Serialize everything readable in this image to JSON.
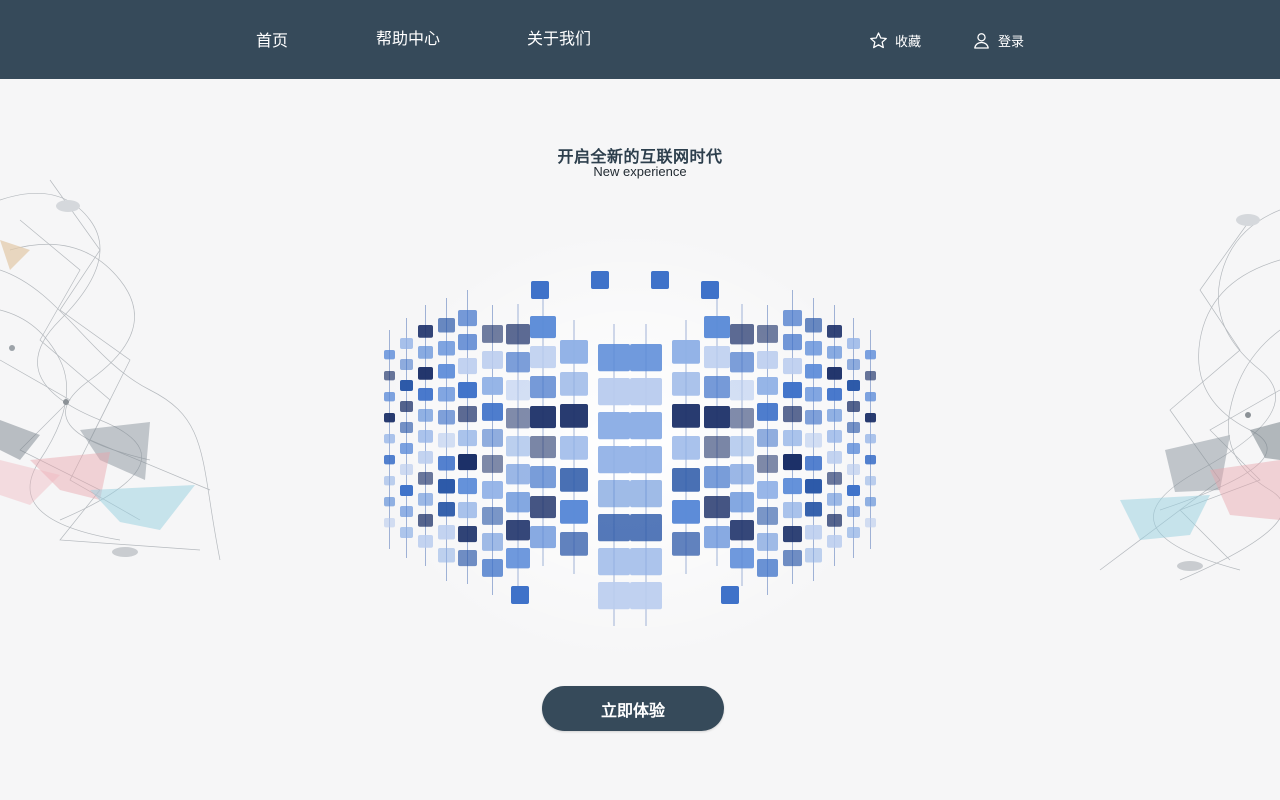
{
  "nav": {
    "items": [
      {
        "label": "首页"
      },
      {
        "label": "帮助中心"
      },
      {
        "label": "关于我们"
      }
    ],
    "favorite": {
      "label": "收藏",
      "icon": "star-icon"
    },
    "login": {
      "label": "登录",
      "icon": "user-icon"
    }
  },
  "hero": {
    "title": "开启全新的互联网时代",
    "subtitle": "New experience"
  },
  "cta": {
    "label": "立即体验"
  },
  "colors": {
    "navbar": "#364a5a",
    "background": "#f6f6f7",
    "accent_blue": "#3f72c9",
    "dark_blue": "#1c3068",
    "light_blue": "#8fb0e6"
  }
}
